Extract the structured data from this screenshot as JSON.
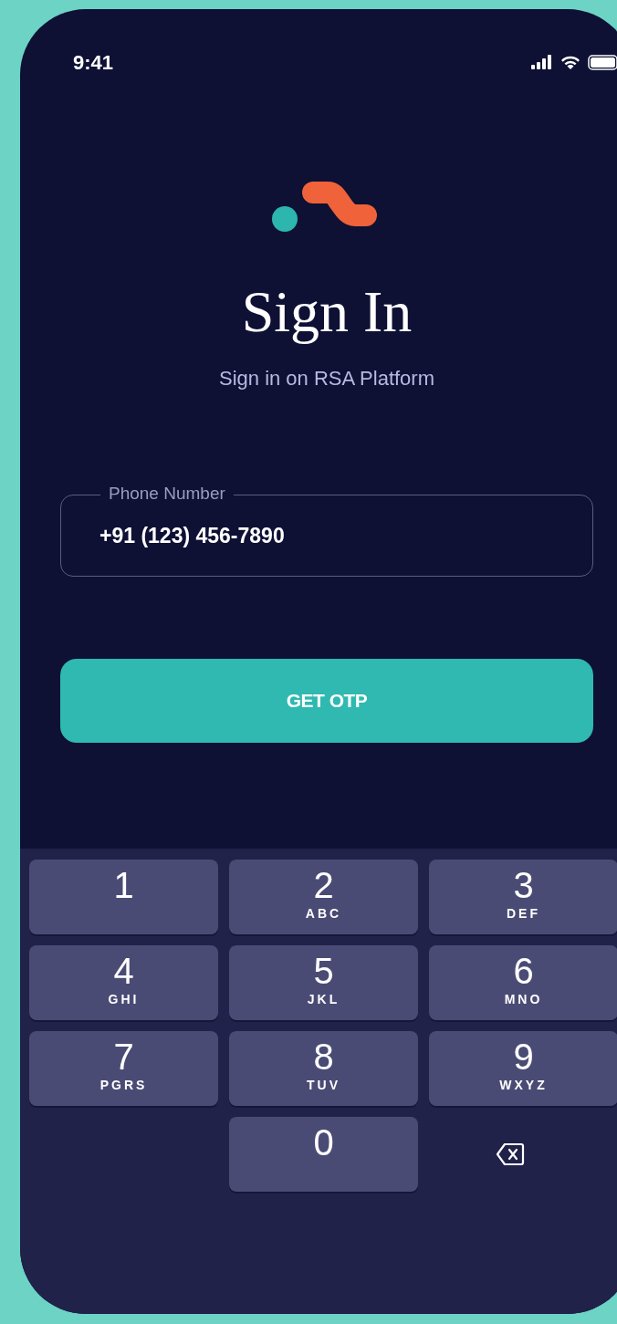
{
  "status_bar": {
    "time": "9:41"
  },
  "title": "Sign In",
  "subtitle": "Sign in on RSA Platform",
  "phone_field": {
    "label": "Phone Number",
    "value": "+91 (123) 456-7890"
  },
  "button": {
    "label": "GET OTP"
  },
  "keypad": [
    {
      "kind": "digit",
      "digit": "1"
    },
    {
      "kind": "digit",
      "digit": "2",
      "letters": "ABC"
    },
    {
      "kind": "digit",
      "digit": "3",
      "letters": "DEF"
    },
    {
      "kind": "digit",
      "digit": "4",
      "letters": "GHI"
    },
    {
      "kind": "digit",
      "digit": "5",
      "letters": "JKL"
    },
    {
      "kind": "digit",
      "digit": "6",
      "letters": "MNO"
    },
    {
      "kind": "digit",
      "digit": "7",
      "letters": "PGRS"
    },
    {
      "kind": "digit",
      "digit": "8",
      "letters": "TUV"
    },
    {
      "kind": "digit",
      "digit": "9",
      "letters": "WXYZ"
    },
    {
      "kind": "blank"
    },
    {
      "kind": "digit",
      "digit": "0"
    },
    {
      "kind": "delete"
    }
  ]
}
